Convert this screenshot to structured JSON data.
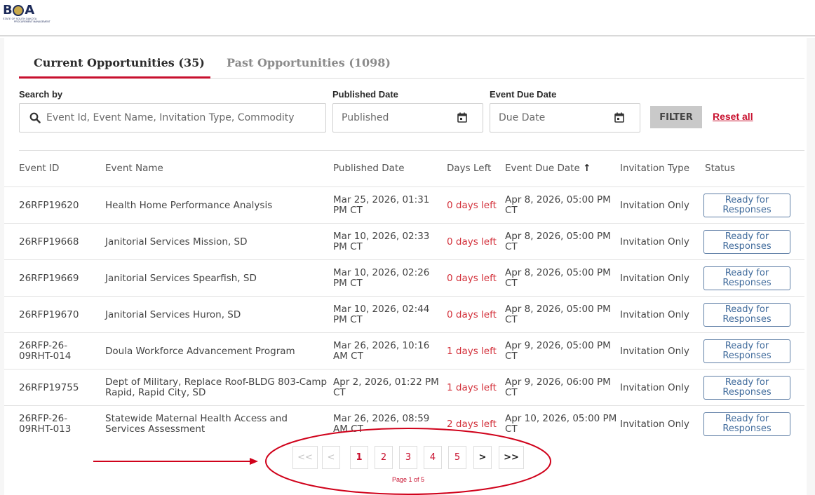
{
  "header": {
    "logo_letters": [
      "B",
      "A"
    ],
    "logo_subtitle": "STATE OF SOUTH DAKOTA",
    "logo_subtitle2": "PROCUREMENT MANAGEMENT"
  },
  "tabs": [
    {
      "label": "Current Opportunities (35)",
      "active": true
    },
    {
      "label": "Past Opportunities (1098)",
      "active": false
    }
  ],
  "filters": {
    "search_label": "Search by",
    "search_placeholder": "Event Id, Event Name, Invitation Type, Commodity",
    "published_label": "Published Date",
    "published_placeholder": "Published",
    "due_label": "Event Due Date",
    "due_placeholder": "Due Date",
    "filter_button": "FILTER",
    "reset_link": "Reset all"
  },
  "table": {
    "columns": [
      "Event ID",
      "Event Name",
      "Published Date",
      "Days Left",
      "Event Due Date",
      "Invitation Type",
      "Status"
    ],
    "sort_indicator": "↑",
    "rows": [
      {
        "id": "26RFP19620",
        "name": "Health Home Performance Analysis",
        "published": "Mar 25, 2026, 01:31 PM CT",
        "days": "0 days left",
        "due": "Apr 8, 2026, 05:00 PM CT",
        "invitation": "Invitation Only",
        "status": "Ready for Responses"
      },
      {
        "id": "26RFP19668",
        "name": "Janitorial Services Mission, SD",
        "published": "Mar 10, 2026, 02:33 PM CT",
        "days": "0 days left",
        "due": "Apr 8, 2026, 05:00 PM CT",
        "invitation": "Invitation Only",
        "status": "Ready for Responses"
      },
      {
        "id": "26RFP19669",
        "name": "Janitorial Services Spearfish, SD",
        "published": "Mar 10, 2026, 02:26 PM CT",
        "days": "0 days left",
        "due": "Apr 8, 2026, 05:00 PM CT",
        "invitation": "Invitation Only",
        "status": "Ready for Responses"
      },
      {
        "id": "26RFP19670",
        "name": "Janitorial Services Huron, SD",
        "published": "Mar 10, 2026, 02:44 PM CT",
        "days": "0 days left",
        "due": "Apr 8, 2026, 05:00 PM CT",
        "invitation": "Invitation Only",
        "status": "Ready for Responses"
      },
      {
        "id": "26RFP-26-09RHT-014",
        "name": "Doula Workforce Advancement Program",
        "published": "Mar 26, 2026, 10:16 AM CT",
        "days": "1 days left",
        "due": "Apr 9, 2026, 05:00 PM CT",
        "invitation": "Invitation Only",
        "status": "Ready for Responses"
      },
      {
        "id": "26RFP19755",
        "name": "Dept of Military, Replace Roof-BLDG 803-Camp Rapid, Rapid City, SD",
        "published": "Apr 2, 2026, 01:22 PM CT",
        "days": "1 days left",
        "due": "Apr 9, 2026, 06:00 PM CT",
        "invitation": "Invitation Only",
        "status": "Ready for Responses"
      },
      {
        "id": "26RFP-26-09RHT-013",
        "name": "Statewide Maternal Health Access and Services Assessment",
        "published": "Mar 26, 2026, 08:59 AM CT",
        "days": "2 days left",
        "due": "Apr 10, 2026, 05:00 PM CT",
        "invitation": "Invitation Only",
        "status": "Ready for Responses"
      }
    ]
  },
  "pagination": {
    "first": "<<",
    "prev": "<",
    "pages": [
      "1",
      "2",
      "3",
      "4",
      "5"
    ],
    "current_page": "1",
    "next": ">",
    "last": ">>",
    "info": "Page 1 of 5"
  },
  "colors": {
    "accent": "#c8102e",
    "brand": "#1d2b5a",
    "status_border": "#5f7fa6",
    "filter_bg": "#c9c9c9"
  }
}
